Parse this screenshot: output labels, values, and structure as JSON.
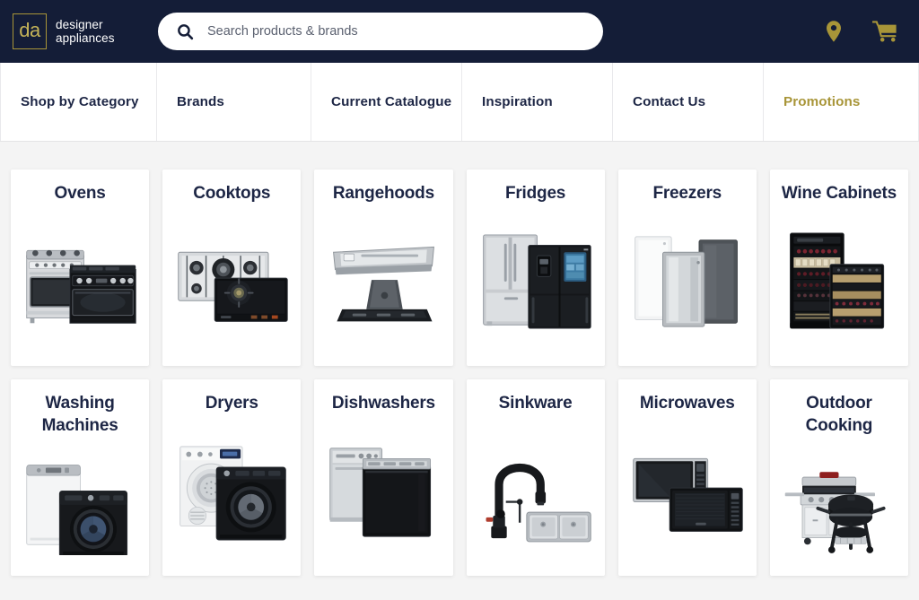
{
  "brand": {
    "mark_text": "da",
    "name_line1": "designer",
    "name_line2": "appliances",
    "gold": "#a89538",
    "navy": "#141d37"
  },
  "search": {
    "placeholder": "Search products & brands",
    "value": "",
    "icon": "search-icon"
  },
  "header_actions": [
    {
      "icon": "location-pin-icon",
      "label": "Store locator"
    },
    {
      "icon": "shopping-cart-icon",
      "label": "Cart"
    }
  ],
  "nav": {
    "items": [
      {
        "label": "Shop by Category",
        "highlighted": false
      },
      {
        "label": "Brands",
        "highlighted": false
      },
      {
        "label": "Current Catalogue",
        "highlighted": false
      },
      {
        "label": "Inspiration",
        "highlighted": false
      },
      {
        "label": "Contact Us",
        "highlighted": false
      },
      {
        "label": "Promotions",
        "highlighted": true
      }
    ]
  },
  "categories": [
    {
      "title": "Ovens",
      "art": "oven"
    },
    {
      "title": "Cooktops",
      "art": "cooktop"
    },
    {
      "title": "Rangehoods",
      "art": "rangehood"
    },
    {
      "title": "Fridges",
      "art": "fridge"
    },
    {
      "title": "Freezers",
      "art": "freezer"
    },
    {
      "title": "Wine Cabinets",
      "art": "wine"
    },
    {
      "title": "Washing Machines",
      "art": "washer"
    },
    {
      "title": "Dryers",
      "art": "dryer"
    },
    {
      "title": "Dishwashers",
      "art": "dishwasher"
    },
    {
      "title": "Sinkware",
      "art": "sink"
    },
    {
      "title": "Microwaves",
      "art": "microwave"
    },
    {
      "title": "Outdoor Cooking",
      "art": "bbq"
    }
  ]
}
